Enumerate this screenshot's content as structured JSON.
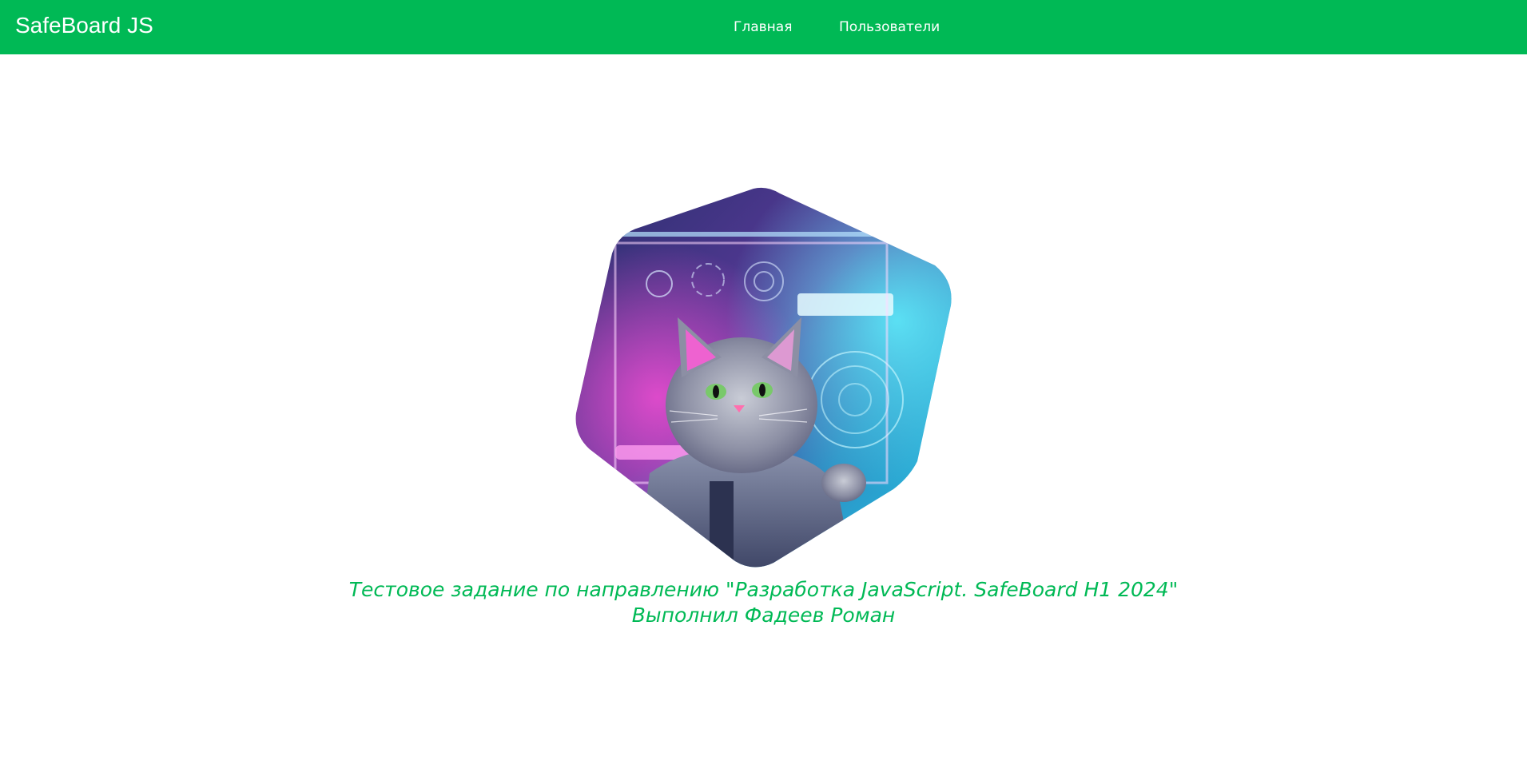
{
  "header": {
    "brand": "SafeBoard JS",
    "nav": [
      {
        "label": "Главная"
      },
      {
        "label": "Пользователи"
      }
    ]
  },
  "main": {
    "image": "cyberpunk-cat-illustration",
    "caption_line1": "Тестовое задание по направлению \"Разработка JavaScript. SafeBoard H1 2024\"",
    "caption_line2": "Выполнил Фадеев Роман"
  },
  "colors": {
    "accent": "#00b955",
    "background": "#ffffff",
    "nav_text": "#ffffff"
  }
}
